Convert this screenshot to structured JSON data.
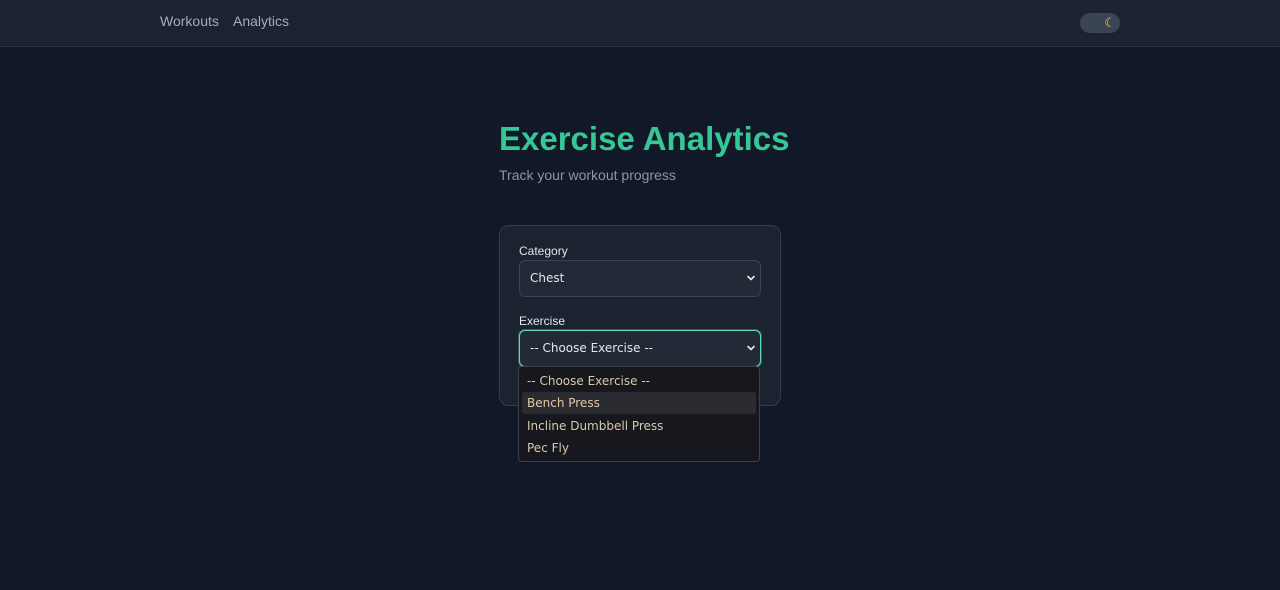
{
  "nav": {
    "links": [
      "Workouts",
      "Analytics"
    ],
    "theme_toggle_icon": "moon-icon"
  },
  "header": {
    "title": "Exercise Analytics",
    "subtitle": "Track your workout progress"
  },
  "form": {
    "category_label": "Category",
    "category_value": "Chest",
    "exercise_label": "Exercise",
    "exercise_value": "-- Choose Exercise --",
    "exercise_options": [
      "-- Choose Exercise --",
      "Bench Press",
      "Incline Dumbbell Press",
      "Pec Fly"
    ],
    "highlighted_option": "Bench Press"
  },
  "colors": {
    "background": "#111827",
    "accent": "#35c795",
    "focus_ring": "#5fd9b0"
  }
}
